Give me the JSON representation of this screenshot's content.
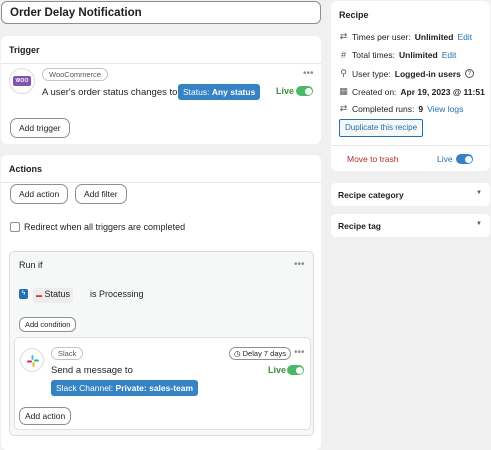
{
  "recipe_title": "Order Delay Notification",
  "trigger": {
    "heading": "Trigger",
    "integration_tag": "WooCommerce",
    "logo_text": "WOO",
    "sentence": "A user's order status changes to",
    "pill_key": "Status:",
    "pill_value": "Any status",
    "live_label": "Live",
    "add_button": "Add trigger"
  },
  "actions": {
    "heading": "Actions",
    "add_action_button": "Add action",
    "add_filter_button": "Add filter",
    "redirect_label": "Redirect when all triggers are completed",
    "run_if": {
      "heading": "Run if",
      "field_chip": "Status",
      "condition_text": "is Processing",
      "add_condition_button": "Add condition"
    },
    "slack_action": {
      "integration_tag": "Slack",
      "delay_label": "Delay 7 days",
      "sentence": "Send a message to",
      "pill_key": "Slack Channel:",
      "pill_value": "Private: sales-team",
      "live_label": "Live",
      "add_action_button": "Add action"
    }
  },
  "recipe_panel": {
    "heading": "Recipe",
    "rows": [
      {
        "icon": "repeat-icon",
        "label": "Times per user:",
        "value": "Unlimited",
        "link": "Edit"
      },
      {
        "icon": "hash-icon",
        "label": "Total times:",
        "value": "Unlimited",
        "link": "Edit"
      },
      {
        "icon": "user-icon",
        "label": "User type:",
        "value": "Logged-in users",
        "link": "?"
      },
      {
        "icon": "calendar-icon",
        "label": "Created on:",
        "value": "Apr 19, 2023 @ 11:51",
        "link": ""
      },
      {
        "icon": "repeat-icon",
        "label": "Completed runs:",
        "value": "9",
        "link": "View logs"
      }
    ],
    "duplicate_button": "Duplicate this recipe",
    "trash_link": "Move to trash",
    "live_label": "Live"
  },
  "recipe_category": {
    "label": "Recipe category"
  },
  "recipe_tag": {
    "label": "Recipe tag"
  },
  "colors": {
    "accent": "#3582c4",
    "live_green": "#4ab866",
    "trash_red": "#b32d2e",
    "woo_purple": "#7f54b3"
  }
}
